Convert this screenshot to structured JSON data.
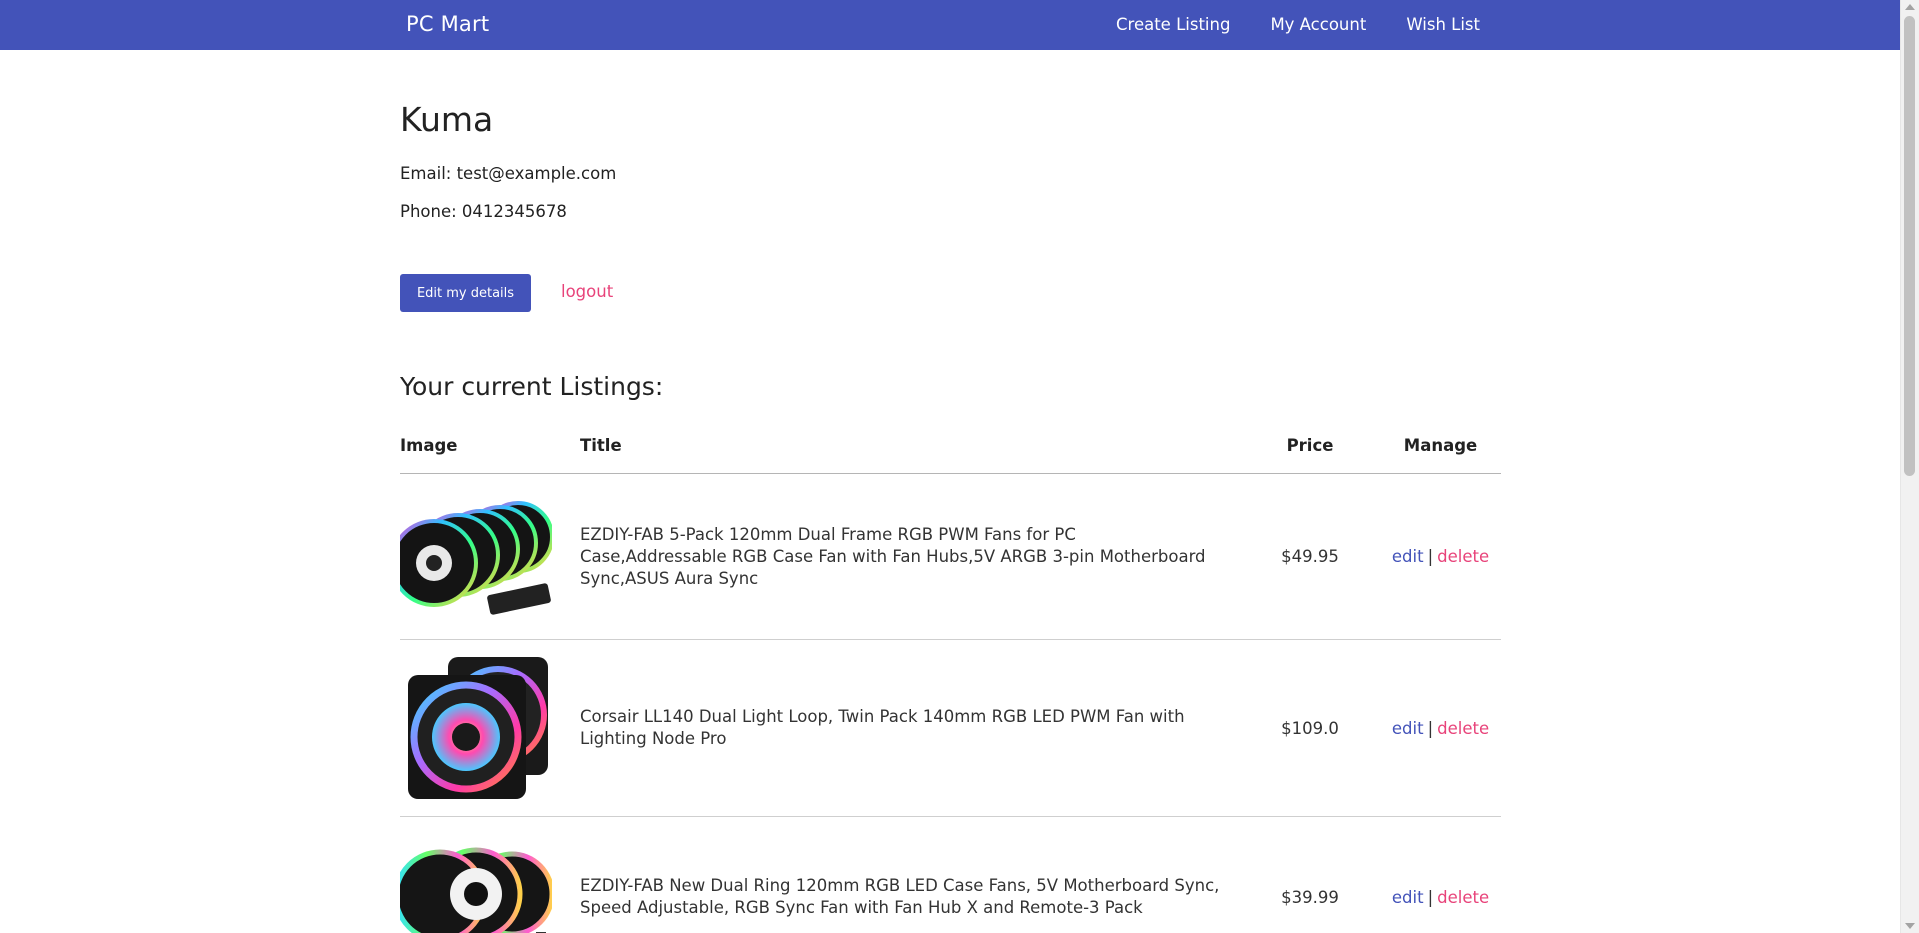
{
  "navbar": {
    "brand": "PC Mart",
    "links": [
      "Create Listing",
      "My Account",
      "Wish List"
    ]
  },
  "profile": {
    "name": "Kuma",
    "email_line": "Email: test@example.com",
    "phone_line": "Phone: 0412345678",
    "edit_button_label": "Edit my details",
    "logout_label": "logout"
  },
  "listings": {
    "heading": "Your current Listings:",
    "columns": {
      "image": "Image",
      "title": "Title",
      "price": "Price",
      "manage": "Manage"
    },
    "rows": [
      {
        "image_icon": "rgb-fan-5-pack-image",
        "title": "EZDIY-FAB 5-Pack 120mm Dual Frame RGB PWM Fans for PC Case,Addressable RGB Case Fan with Fan Hubs,5V ARGB 3-pin Motherboard Sync,ASUS Aura Sync",
        "price": "$49.95",
        "edit_label": "edit",
        "separator": "|",
        "delete_label": "delete"
      },
      {
        "image_icon": "corsair-fan-twin-pack-image",
        "title": "Corsair LL140 Dual Light Loop, Twin Pack 140mm RGB LED PWM Fan with Lighting Node Pro",
        "price": "$109.0",
        "edit_label": "edit",
        "separator": "|",
        "delete_label": "delete"
      },
      {
        "image_icon": "rgb-fan-3-pack-image",
        "title": "EZDIY-FAB New Dual Ring 120mm RGB LED Case Fans, 5V Motherboard Sync, Speed Adjustable, RGB Sync Fan with Fan Hub X and Remote-3 Pack",
        "price": "$39.99",
        "edit_label": "edit",
        "separator": "|",
        "delete_label": "delete"
      }
    ]
  },
  "colors": {
    "primary": "#4353b9",
    "danger_link": "#e8437a",
    "text": "#222222"
  }
}
